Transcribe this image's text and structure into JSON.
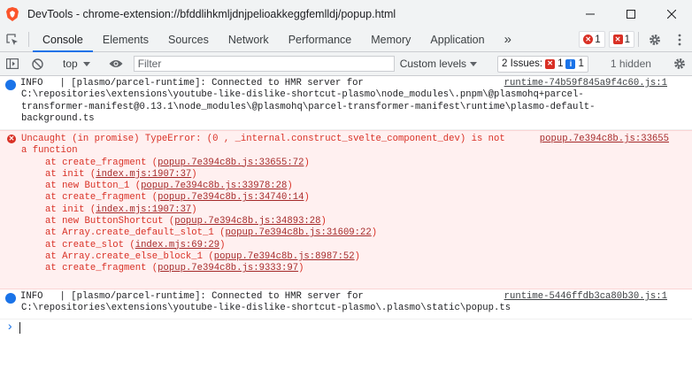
{
  "window": {
    "title": "DevTools - chrome-extension://bfddlihkmljdnjpelioakkeggfemlldj/popup.html"
  },
  "tabs": {
    "items": [
      "Console",
      "Elements",
      "Sources",
      "Network",
      "Performance",
      "Memory",
      "Application"
    ],
    "more": "»",
    "errors_count": "1",
    "warnings_count": "1"
  },
  "toolbar": {
    "context": "top",
    "filter_placeholder": "Filter",
    "levels": "Custom levels",
    "issues_label": "2 Issues:",
    "issues_errors": "1",
    "issues_info": "1",
    "hidden": "1 hidden"
  },
  "console": {
    "msg1": {
      "level": "INFO",
      "line1": "INFO   | [plasmo/parcel-runtime]: Connected to HMR server for",
      "line2": "C:\\repositories\\extensions\\youtube-like-dislike-shortcut-plasmo\\node_modules\\.pnpm\\@plasmohq+parcel-",
      "line3": "transformer-manifest@0.13.1\\node_modules\\@plasmohq\\parcel-transformer-manifest\\runtime\\plasmo-default-",
      "line4": "background.ts",
      "source": "runtime-74b59f845a9f4c60.js:1"
    },
    "msg2": {
      "line1": "Uncaught (in promise) TypeError: (0 , _internal.construct_svelte_component_dev) is not",
      "line2": "a function",
      "source": "popup.7e394c8b.js:33655",
      "stack": [
        {
          "fn": "at create_fragment (",
          "loc": "popup.7e394c8b.js:33655:72",
          "end": ")"
        },
        {
          "fn": "at init (",
          "loc": "index.mjs:1907:37",
          "end": ")"
        },
        {
          "fn": "at new Button_1 (",
          "loc": "popup.7e394c8b.js:33978:28",
          "end": ")"
        },
        {
          "fn": "at create_fragment (",
          "loc": "popup.7e394c8b.js:34740:14",
          "end": ")"
        },
        {
          "fn": "at init (",
          "loc": "index.mjs:1907:37",
          "end": ")"
        },
        {
          "fn": "at new ButtonShortcut (",
          "loc": "popup.7e394c8b.js:34893:28",
          "end": ")"
        },
        {
          "fn": "at Array.create_default_slot_1 (",
          "loc": "popup.7e394c8b.js:31609:22",
          "end": ")"
        },
        {
          "fn": "at create_slot (",
          "loc": "index.mjs:69:29",
          "end": ")"
        },
        {
          "fn": "at Array.create_else_block_1 (",
          "loc": "popup.7e394c8b.js:8987:52",
          "end": ")"
        },
        {
          "fn": "at create_fragment (",
          "loc": "popup.7e394c8b.js:9333:97",
          "end": ")"
        }
      ]
    },
    "msg3": {
      "line1": "INFO   | [plasmo/parcel-runtime]: Connected to HMR server for",
      "line2": "C:\\repositories\\extensions\\youtube-like-dislike-shortcut-plasmo\\.plasmo\\static\\popup.ts",
      "source": "runtime-5446ffdb3ca80b30.js:1"
    },
    "prompt_symbol": "›"
  },
  "colors": {
    "accent": "#1a73e8",
    "error": "#d93025",
    "error_bg": "#fff0f0"
  }
}
